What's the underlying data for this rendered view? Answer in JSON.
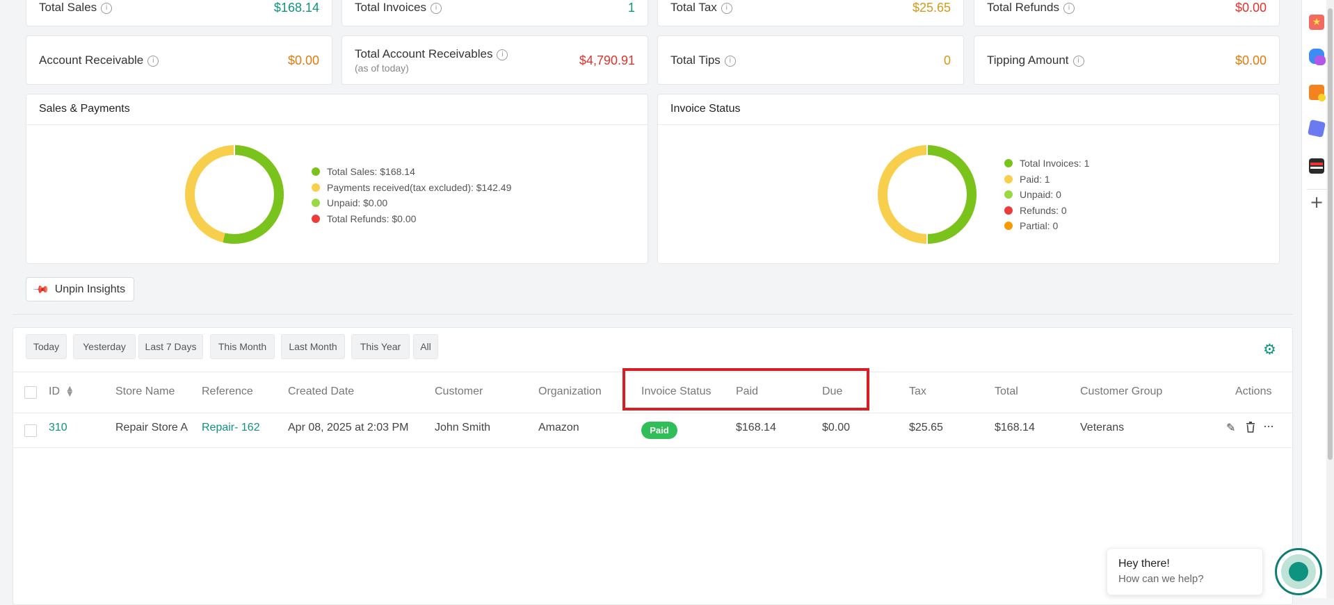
{
  "stats_row1": [
    {
      "label": "Total Sales",
      "value": "$168.14",
      "color": "#0d9380"
    },
    {
      "label": "Total Invoices",
      "value": "1",
      "color": "#0d9380"
    },
    {
      "label": "Total Tax",
      "value": "$25.65",
      "color": "#d39a1a"
    },
    {
      "label": "Total Refunds",
      "value": "$0.00",
      "color": "#e0332d"
    }
  ],
  "stats_row2": [
    {
      "label": "Account Receivable",
      "sub": "",
      "value": "$0.00",
      "color": "#e07b0b"
    },
    {
      "label": "Total Account Receivables",
      "sub": "(as of today)",
      "value": "$4,790.91",
      "color": "#e0332d"
    },
    {
      "label": "Total Tips",
      "sub": "",
      "value": "0",
      "color": "#d39a1a"
    },
    {
      "label": "Tipping Amount",
      "sub": "",
      "value": "$0.00",
      "color": "#e07b0b"
    }
  ],
  "sales_panel": {
    "title": "Sales & Payments",
    "legend": [
      {
        "label": "Total Sales: $168.14",
        "color": "#7ac31c"
      },
      {
        "label": "Payments received(tax excluded): $142.49",
        "color": "#f8cf4c"
      },
      {
        "label": "Unpaid: $0.00",
        "color": "#9ad944"
      },
      {
        "label": "Total Refunds: $0.00",
        "color": "#ec3b3b"
      }
    ]
  },
  "invoice_panel": {
    "title": "Invoice Status",
    "legend": [
      {
        "label": "Total Invoices: 1",
        "color": "#7ac31c"
      },
      {
        "label": "Paid: 1",
        "color": "#f8cf4c"
      },
      {
        "label": "Unpaid: 0",
        "color": "#9ad944"
      },
      {
        "label": "Refunds: 0",
        "color": "#ec3b3b"
      },
      {
        "label": "Partial: 0",
        "color": "#f59b00"
      }
    ]
  },
  "unpin_label": "Unpin Insights",
  "filters": [
    "Today",
    "Yesterday",
    "Last 7 Days",
    "This Month",
    "Last Month",
    "This Year",
    "All"
  ],
  "table": {
    "headers": [
      "ID",
      "Store Name",
      "Reference",
      "Created Date",
      "Customer",
      "Organization",
      "Invoice Status",
      "Paid",
      "Due",
      "Tax",
      "Total",
      "Customer Group",
      "Actions"
    ],
    "row": {
      "id": "310",
      "store": "Repair Store A",
      "reference": "Repair- 162",
      "created": "Apr 08, 2025 at 2:03 PM",
      "customer": "John Smith",
      "organization": "Amazon",
      "status": "Paid",
      "paid": "$168.14",
      "due": "$0.00",
      "tax": "$25.65",
      "total": "$168.14",
      "group": "Veterans"
    }
  },
  "chat": {
    "title": "Hey there!",
    "subtitle": "How can we help?"
  },
  "accent": "#0d9380",
  "highlight": "#d91d24"
}
